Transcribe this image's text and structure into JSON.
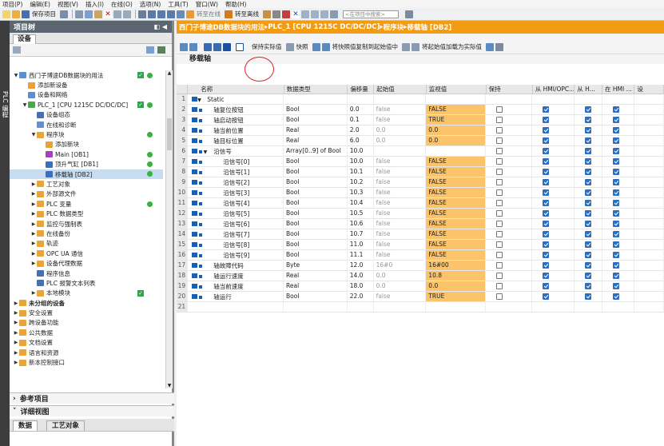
{
  "menu": [
    "项目(P)",
    "编辑(E)",
    "视图(V)",
    "插入(I)",
    "在线(O)",
    "选项(N)",
    "工具(T)",
    "窗口(W)",
    "帮助(H)"
  ],
  "toolbar": {
    "save_project": "保存项目",
    "go_online": "转至在线",
    "go_offline": "转至离线",
    "search_placeholder": "<在项目中搜索>"
  },
  "vertical_tab": "PLC 编程",
  "project_tree": {
    "title": "项目树",
    "devices_tab": "设备",
    "items": [
      {
        "label": "西门子博途DB数据块的用法",
        "level": 0,
        "arrow": "▼",
        "icon": "#5b8fd4",
        "status": "check-dot"
      },
      {
        "label": "添加新设备",
        "level": 1,
        "arrow": "",
        "icon": "#f0a030"
      },
      {
        "label": "设备和网络",
        "level": 1,
        "arrow": "",
        "icon": "#5b8fd4"
      },
      {
        "label": "PLC_1 [CPU 1215C DC/DC/DC]",
        "level": 1,
        "arrow": "▼",
        "icon": "#4aa84a",
        "status": "check-dot",
        "selected": false
      },
      {
        "label": "设备组态",
        "level": 2,
        "arrow": "",
        "icon": "#4a6fb0"
      },
      {
        "label": "在线和诊断",
        "level": 2,
        "arrow": "",
        "icon": "#6a8fc8"
      },
      {
        "label": "程序块",
        "level": 2,
        "arrow": "▼",
        "icon": "#e8a53c",
        "status": "dot"
      },
      {
        "label": "添加新块",
        "level": 3,
        "arrow": "",
        "icon": "#f0a030"
      },
      {
        "label": "Main [OB1]",
        "level": 3,
        "arrow": "",
        "icon": "#b03ac0",
        "status": "dot"
      },
      {
        "label": "顶升气缸 [DB1]",
        "level": 3,
        "arrow": "",
        "icon": "#3a6ec0",
        "status": "dot"
      },
      {
        "label": "移载轴 [DB2]",
        "level": 3,
        "arrow": "",
        "icon": "#3a6ec0",
        "status": "dot",
        "selected": true
      },
      {
        "label": "工艺对象",
        "level": 2,
        "arrow": "▶",
        "icon": "#e8a53c"
      },
      {
        "label": "外部源文件",
        "level": 2,
        "arrow": "▶",
        "icon": "#e8a53c"
      },
      {
        "label": "PLC 变量",
        "level": 2,
        "arrow": "▶",
        "icon": "#e8a53c",
        "status": "dot"
      },
      {
        "label": "PLC 数据类型",
        "level": 2,
        "arrow": "▶",
        "icon": "#e8a53c"
      },
      {
        "label": "监控与强制表",
        "level": 2,
        "arrow": "▶",
        "icon": "#e8a53c"
      },
      {
        "label": "在线备份",
        "level": 2,
        "arrow": "▶",
        "icon": "#e8a53c"
      },
      {
        "label": "轨迹",
        "level": 2,
        "arrow": "▶",
        "icon": "#e8a53c"
      },
      {
        "label": "OPC UA 通信",
        "level": 2,
        "arrow": "▶",
        "icon": "#e8a53c"
      },
      {
        "label": "设备代理数据",
        "level": 2,
        "arrow": "▶",
        "icon": "#e8a53c"
      },
      {
        "label": "程序信息",
        "level": 2,
        "arrow": "",
        "icon": "#4a6fb0"
      },
      {
        "label": "PLC 报警文本列表",
        "level": 2,
        "arrow": "",
        "icon": "#4a6fb0"
      },
      {
        "label": "本地模块",
        "level": 2,
        "arrow": "▶",
        "icon": "#e8a53c",
        "status": "check"
      },
      {
        "label": "未分组的设备",
        "level": 0,
        "arrow": "▶",
        "icon": "#e8a53c",
        "bold": true
      },
      {
        "label": "安全设置",
        "level": 0,
        "arrow": "▶",
        "icon": "#e8a53c"
      },
      {
        "label": "跨设备功能",
        "level": 0,
        "arrow": "▶",
        "icon": "#e8a53c"
      },
      {
        "label": "公共数据",
        "level": 0,
        "arrow": "▶",
        "icon": "#e8a53c"
      },
      {
        "label": "文档设置",
        "level": 0,
        "arrow": "▶",
        "icon": "#e8a53c"
      },
      {
        "label": "语言和资源",
        "level": 0,
        "arrow": "▶",
        "icon": "#e8a53c"
      },
      {
        "label": "新本控制接口",
        "level": 0,
        "arrow": "▶",
        "icon": "#e8a53c"
      }
    ],
    "reference_projects": "参考项目",
    "details_view": "详细视图",
    "detail_tabs": [
      "数据",
      "工艺对象"
    ]
  },
  "editor": {
    "breadcrumb": [
      "西门子博途DB数据块的用法",
      "PLC_1 [CPU 1215C DC/DC/DC]",
      "程序块",
      "移载轴 [DB2]"
    ],
    "toolbar_labels": {
      "keep_actual": "保持实际值",
      "snapshot": "快照",
      "copy_snapshot": "将快照值复制到起始值中",
      "load_start": "将起始值加载为实际值"
    },
    "block_name": "移载轴",
    "columns": [
      "名称",
      "数据类型",
      "偏移量",
      "起始值",
      "监视值",
      "保持",
      "从 HMI/OPC...",
      "从 H...",
      "在 HMI ...",
      "设"
    ],
    "rows": [
      {
        "n": "1",
        "name": "Static",
        "indent": 0,
        "exp": "▼",
        "type": "",
        "off": "",
        "start": "",
        "mon": "",
        "cb": false,
        "kind": "section"
      },
      {
        "n": "2",
        "name": "轴复位按钮",
        "indent": 1,
        "exp": "",
        "type": "Bool",
        "off": "0.0",
        "start": "false",
        "mon": "FALSE",
        "cb": true
      },
      {
        "n": "3",
        "name": "轴启动按钮",
        "indent": 1,
        "exp": "",
        "type": "Bool",
        "off": "0.1",
        "start": "false",
        "mon": "TRUE",
        "cb": true
      },
      {
        "n": "4",
        "name": "轴当前位置",
        "indent": 1,
        "exp": "",
        "type": "Real",
        "off": "2.0",
        "start": "0.0",
        "mon": "0.0",
        "cb": true
      },
      {
        "n": "5",
        "name": "轴目标位置",
        "indent": 1,
        "exp": "",
        "type": "Real",
        "off": "6.0",
        "start": "0.0",
        "mon": "0.0",
        "cb": true
      },
      {
        "n": "6",
        "name": "沿信号",
        "indent": 1,
        "exp": "▼",
        "type": "Array[0..9] of Bool",
        "off": "10.0",
        "start": "",
        "mon": "",
        "cb": true
      },
      {
        "n": "7",
        "name": "沿信号[0]",
        "indent": 2,
        "exp": "",
        "type": "Bool",
        "off": "10.0",
        "start": "false",
        "mon": "FALSE",
        "cb": true
      },
      {
        "n": "8",
        "name": "沿信号[1]",
        "indent": 2,
        "exp": "",
        "type": "Bool",
        "off": "10.1",
        "start": "false",
        "mon": "FALSE",
        "cb": true
      },
      {
        "n": "9",
        "name": "沿信号[2]",
        "indent": 2,
        "exp": "",
        "type": "Bool",
        "off": "10.2",
        "start": "false",
        "mon": "FALSE",
        "cb": true
      },
      {
        "n": "10",
        "name": "沿信号[3]",
        "indent": 2,
        "exp": "",
        "type": "Bool",
        "off": "10.3",
        "start": "false",
        "mon": "FALSE",
        "cb": true
      },
      {
        "n": "11",
        "name": "沿信号[4]",
        "indent": 2,
        "exp": "",
        "type": "Bool",
        "off": "10.4",
        "start": "false",
        "mon": "FALSE",
        "cb": true
      },
      {
        "n": "12",
        "name": "沿信号[5]",
        "indent": 2,
        "exp": "",
        "type": "Bool",
        "off": "10.5",
        "start": "false",
        "mon": "FALSE",
        "cb": true
      },
      {
        "n": "13",
        "name": "沿信号[6]",
        "indent": 2,
        "exp": "",
        "type": "Bool",
        "off": "10.6",
        "start": "false",
        "mon": "FALSE",
        "cb": true
      },
      {
        "n": "14",
        "name": "沿信号[7]",
        "indent": 2,
        "exp": "",
        "type": "Bool",
        "off": "10.7",
        "start": "false",
        "mon": "FALSE",
        "cb": true
      },
      {
        "n": "15",
        "name": "沿信号[8]",
        "indent": 2,
        "exp": "",
        "type": "Bool",
        "off": "11.0",
        "start": "false",
        "mon": "FALSE",
        "cb": true
      },
      {
        "n": "16",
        "name": "沿信号[9]",
        "indent": 2,
        "exp": "",
        "type": "Bool",
        "off": "11.1",
        "start": "false",
        "mon": "FALSE",
        "cb": true
      },
      {
        "n": "17",
        "name": "轴故障代码",
        "indent": 1,
        "exp": "",
        "type": "Byte",
        "off": "12.0",
        "start": "16#0",
        "mon": "16#00",
        "cb": true
      },
      {
        "n": "18",
        "name": "轴运行速度",
        "indent": 1,
        "exp": "",
        "type": "Real",
        "off": "14.0",
        "start": "0.0",
        "mon": "10.8",
        "cb": true
      },
      {
        "n": "19",
        "name": "轴当前速度",
        "indent": 1,
        "exp": "",
        "type": "Real",
        "off": "18.0",
        "start": "0.0",
        "mon": "0.0",
        "cb": true
      },
      {
        "n": "20",
        "name": "轴运行",
        "indent": 1,
        "exp": "",
        "type": "Bool",
        "off": "22.0",
        "start": "false",
        "mon": "TRUE",
        "cb": true
      },
      {
        "n": "21",
        "name": "",
        "indent": 0,
        "exp": "",
        "type": "",
        "off": "",
        "start": "",
        "mon": "",
        "cb": false,
        "kind": "empty"
      }
    ]
  }
}
